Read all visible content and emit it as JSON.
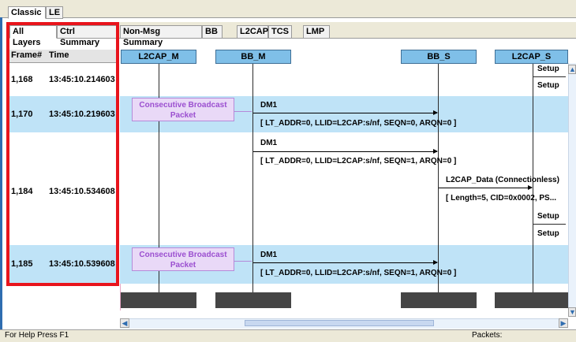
{
  "top_tabs": [
    {
      "label": "Classic",
      "active": true
    },
    {
      "label": "LE",
      "active": false
    }
  ],
  "sub_tabs": [
    {
      "label": "All Layers",
      "active": true
    },
    {
      "label": "Ctrl Summary",
      "active": false
    },
    {
      "label": "Non-Msg Summary",
      "active": false
    },
    {
      "label": "BB",
      "active": false
    },
    {
      "label": "L2CAP",
      "active": false
    },
    {
      "label": "TCS",
      "active": false
    },
    {
      "label": "LMP",
      "active": false
    }
  ],
  "columns": {
    "frame": "Frame#",
    "time": "Time"
  },
  "lifelines": [
    "L2CAP_M",
    "BB_M",
    "BB_S",
    "L2CAP_S"
  ],
  "rows": [
    {
      "frame": "1,168",
      "time": "13:45:10.214603"
    },
    {
      "frame": "1,170",
      "time": "13:45:10.219603"
    },
    {
      "frame": "1,184",
      "time": "13:45:10.534608"
    },
    {
      "frame": "1,185",
      "time": "13:45:10.539608"
    }
  ],
  "consecutive_label": [
    "Consecutive Broadcast",
    "Packet"
  ],
  "messages": [
    {
      "name": "DM1",
      "detail": "[ LT_ADDR=0, LLID=L2CAP:s/nf, SEQN=0, ARQN=0 ]"
    },
    {
      "name": "DM1",
      "detail": "[ LT_ADDR=0, LLID=L2CAP:s/nf, SEQN=1, ARQN=0 ]"
    },
    {
      "name": "L2CAP_Data (Connectionless)",
      "detail": "[ Length=5, CID=0x0002, PS..."
    },
    {
      "name": "DM1",
      "detail": "[ LT_ADDR=0, LLID=L2CAP:s/nf, SEQN=1, ARQN=0 ]"
    }
  ],
  "setup_label": "Setup",
  "status": {
    "help": "For Help Press F1",
    "packets": "Packets:"
  },
  "colors": {
    "highlight_border": "#e8141c",
    "header_blue": "#7fbfe8",
    "band_blue": "#bfe3f7",
    "consecutive_purple": "#9b4fd0"
  }
}
